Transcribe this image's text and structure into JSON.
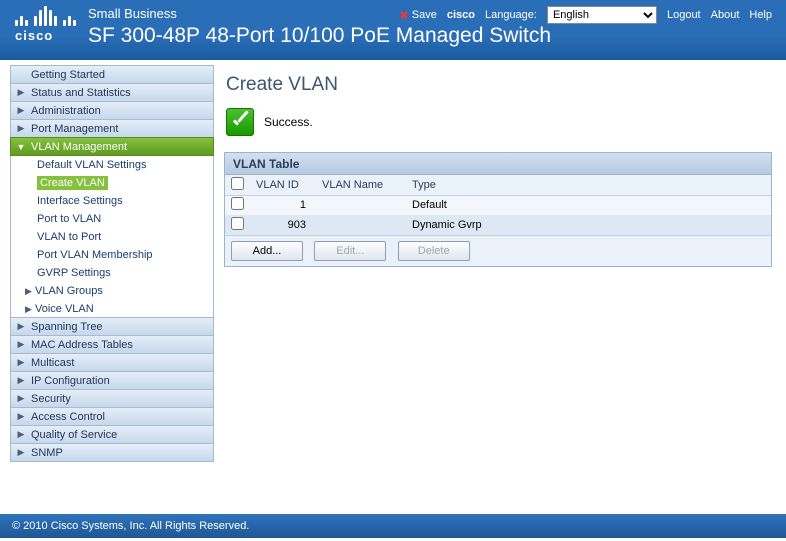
{
  "header": {
    "brand": "Small Business",
    "model": "SF 300-48P 48-Port 10/100 PoE Managed Switch",
    "save": "Save",
    "user": "cisco",
    "language_label": "Language:",
    "language_value": "English",
    "logout": "Logout",
    "about": "About",
    "help": "Help",
    "cisco_word": "cisco"
  },
  "sidebar": {
    "items": [
      {
        "label": "Getting Started",
        "has_sub": false
      },
      {
        "label": "Status and Statistics",
        "has_sub": true
      },
      {
        "label": "Administration",
        "has_sub": true
      },
      {
        "label": "Port Management",
        "has_sub": true
      },
      {
        "label": "VLAN Management",
        "has_sub": true,
        "active": true,
        "sub": [
          {
            "label": "Default VLAN Settings"
          },
          {
            "label": "Create VLAN",
            "selected": true
          },
          {
            "label": "Interface Settings"
          },
          {
            "label": "Port to VLAN"
          },
          {
            "label": "VLAN to Port"
          },
          {
            "label": "Port VLAN Membership"
          },
          {
            "label": "GVRP Settings"
          },
          {
            "label": "VLAN Groups",
            "group": true
          },
          {
            "label": "Voice VLAN",
            "group": true
          }
        ]
      },
      {
        "label": "Spanning Tree",
        "has_sub": true
      },
      {
        "label": "MAC Address Tables",
        "has_sub": true
      },
      {
        "label": "Multicast",
        "has_sub": true
      },
      {
        "label": "IP Configuration",
        "has_sub": true
      },
      {
        "label": "Security",
        "has_sub": true
      },
      {
        "label": "Access Control",
        "has_sub": true
      },
      {
        "label": "Quality of Service",
        "has_sub": true
      },
      {
        "label": "SNMP",
        "has_sub": true
      }
    ]
  },
  "page": {
    "title": "Create VLAN",
    "status": "Success.",
    "table_title": "VLAN Table",
    "columns": {
      "id": "VLAN ID",
      "name": "VLAN Name",
      "type": "Type"
    },
    "rows": [
      {
        "id": "1",
        "name": "",
        "type": "Default"
      },
      {
        "id": "903",
        "name": "",
        "type": "Dynamic Gvrp"
      }
    ],
    "buttons": {
      "add": "Add...",
      "edit": "Edit...",
      "delete": "Delete"
    }
  },
  "footer": "© 2010 Cisco Systems, Inc. All Rights Reserved."
}
